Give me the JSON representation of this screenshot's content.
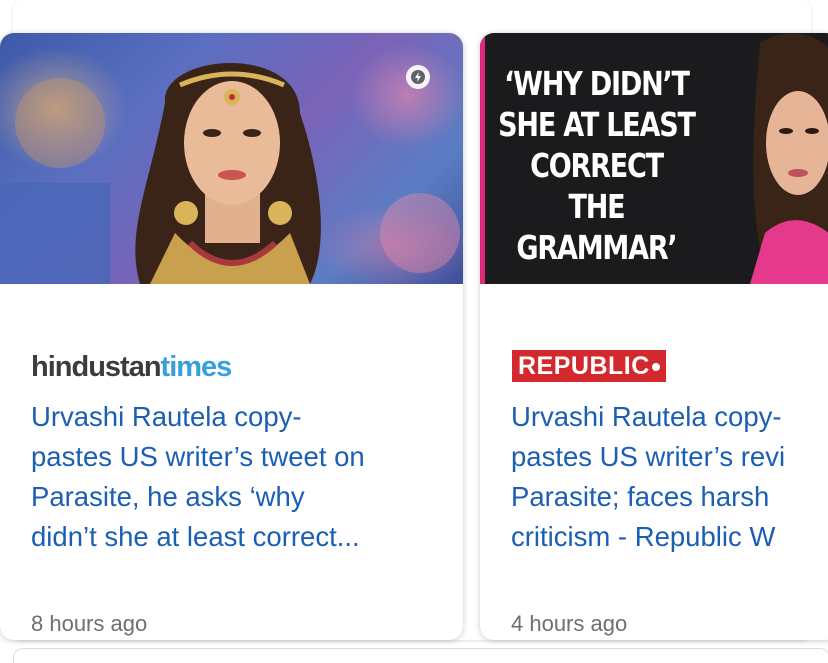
{
  "cards": [
    {
      "source": {
        "part_a": "hindustan",
        "part_b": "times"
      },
      "title_lines": [
        "Urvashi Rautela copy-",
        "pastes US writer’s tweet on",
        "Parasite, he asks ‘why",
        "didn’t she at least correct..."
      ],
      "time": "8 hours ago",
      "badge_icon": "amp-bolt-icon"
    },
    {
      "source": {
        "label": "REPUBLIC"
      },
      "image_headline": [
        "‘WHY DIDN’T",
        "SHE AT LEAST",
        "CORRECT",
        "THE GRAMMAR’"
      ],
      "title_lines": [
        "Urvashi Rautela copy-",
        "pastes US writer’s revi",
        "Parasite; faces harsh",
        "criticism - Republic W"
      ],
      "time": "4 hours ago"
    }
  ],
  "colors": {
    "link": "#1a5fb4",
    "republic_red": "#d2282e",
    "ht_blue": "#35a0dc"
  }
}
